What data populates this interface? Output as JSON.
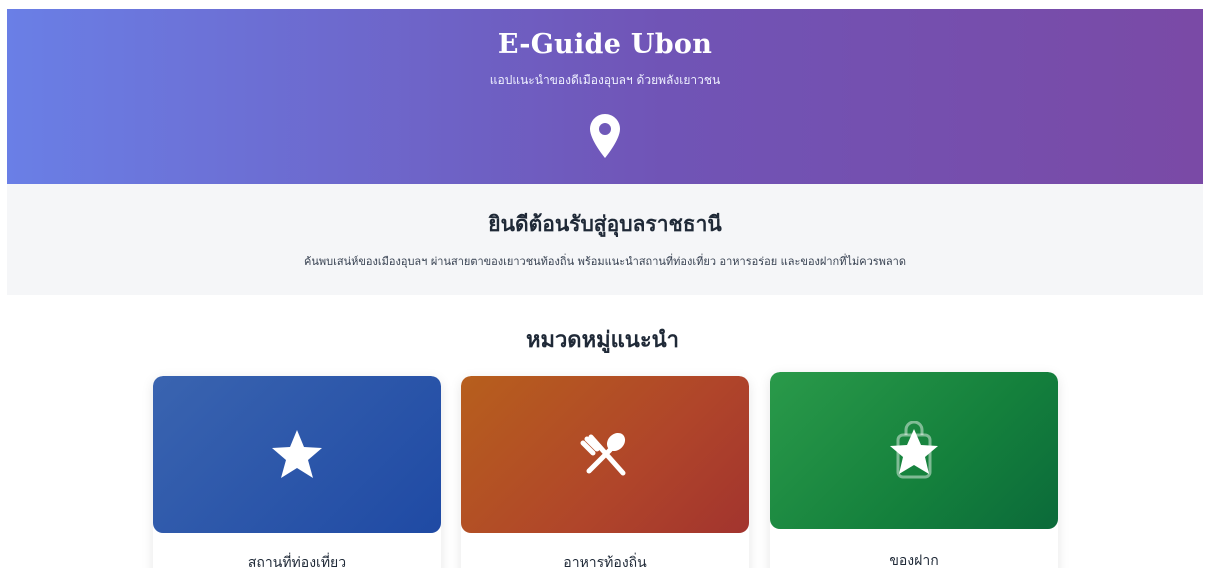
{
  "header": {
    "title": "E-Guide Ubon",
    "subtitle": "แอปแนะนำของดีเมืองอุบลฯ ด้วยพลังเยาวชน",
    "icon": "map-pin-icon"
  },
  "welcome": {
    "title": "ยินดีต้อนรับสู่อุบลราชธานี",
    "description": "ค้นพบเสน่ห์ของเมืองอุบลฯ ผ่านสายตาของเยาวชนท้องถิ่น พร้อมแนะนำสถานที่ท่องเที่ยว อาหารอร่อย และของฝากที่ไม่ควรพลาด"
  },
  "categories": {
    "title": "หมวดหมู่แนะนำ",
    "items": [
      {
        "label": "สถานที่ท่องเที่ยว",
        "icon": "star-icon",
        "color": "#2a55aa"
      },
      {
        "label": "อาหารท้องถิ่น",
        "icon": "fork-spoon-icon",
        "color": "#b04a26"
      },
      {
        "label": "ของฝาก",
        "icon": "gift-bag-star-icon",
        "color": "#168040"
      }
    ]
  },
  "colors": {
    "header_start": "#6a7fe6",
    "header_end": "#7a4aa6",
    "welcome_bg": "#f5f6f8"
  }
}
